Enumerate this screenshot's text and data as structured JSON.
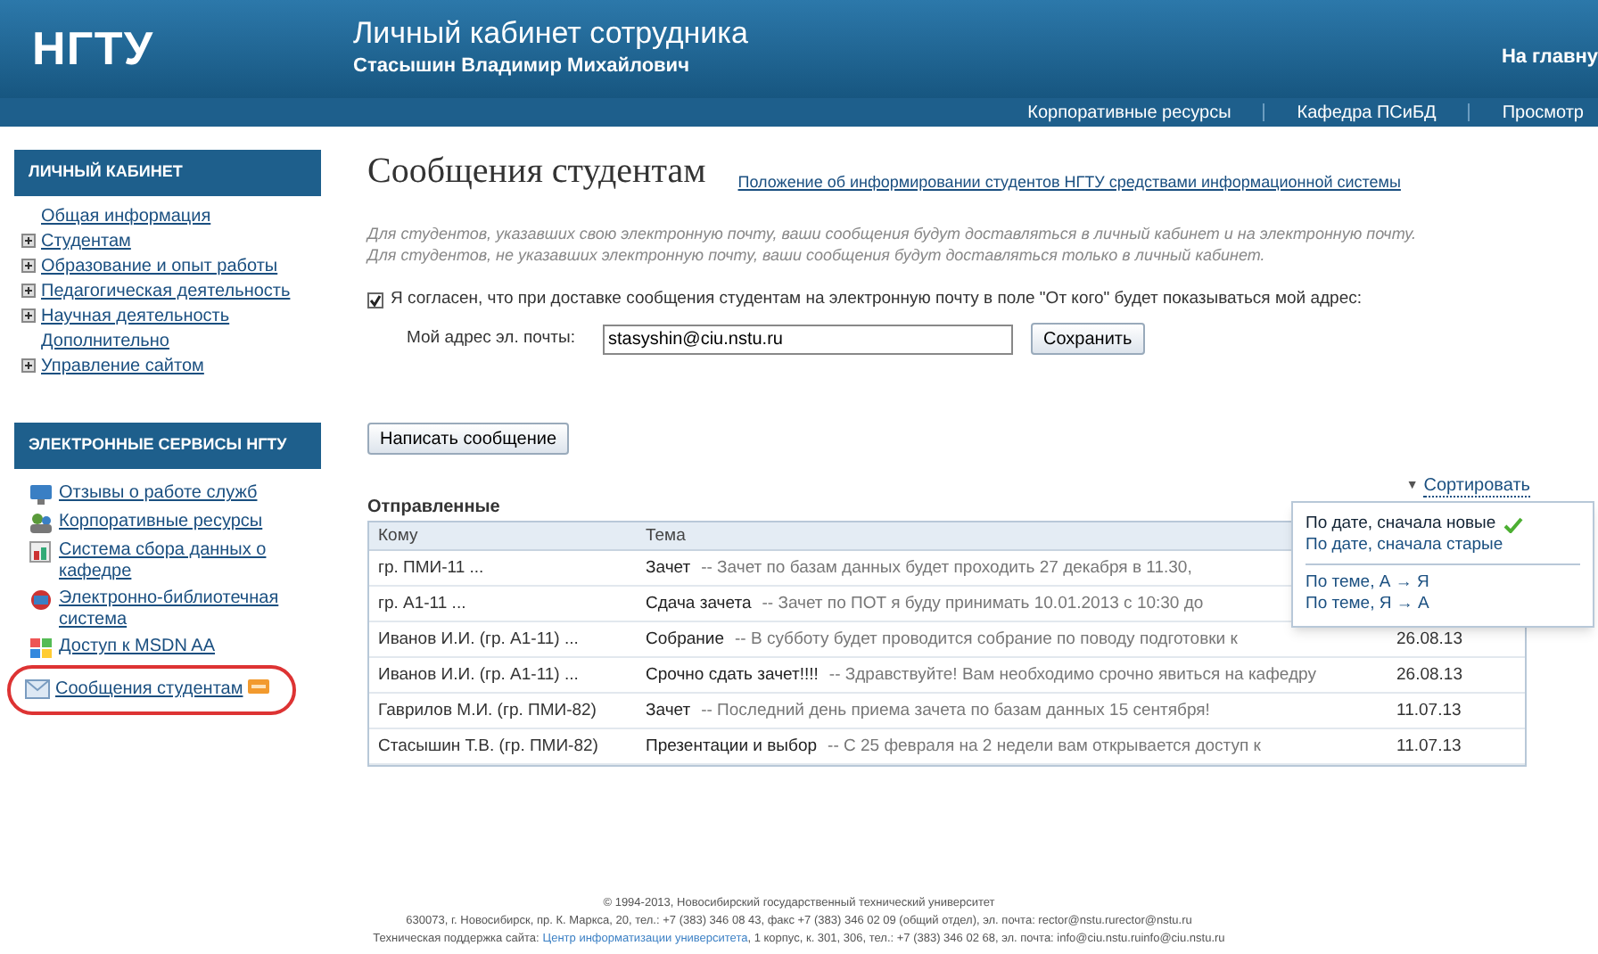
{
  "header": {
    "logo": "НГТУ",
    "title": "Личный кабинет сотрудника",
    "user": "Стасышин Владимир Михайлович",
    "home_link": "На главну"
  },
  "nav": [
    "Корпоративные ресурсы",
    "Кафедра ПСиБД",
    "Просмотр"
  ],
  "sidebar": {
    "cabinet": {
      "title": "ЛИЧНЫЙ КАБИНЕТ",
      "items": [
        {
          "label": "Общая информация",
          "kind": "leaf"
        },
        {
          "label": "Студентам",
          "kind": "node",
          "expanded": false
        },
        {
          "label": "Образование и опыт работы",
          "kind": "node",
          "expanded": false
        },
        {
          "label": "Педагогическая деятельность",
          "kind": "node",
          "expanded": false
        },
        {
          "label": "Научная деятельность",
          "kind": "node",
          "expanded": false
        },
        {
          "label": "Дополнительно",
          "kind": "leaf"
        },
        {
          "label": "Управление сайтом",
          "kind": "node",
          "expanded": false
        }
      ]
    },
    "services": {
      "title": "ЭЛЕКТРОННЫЕ СЕРВИСЫ НГТУ",
      "items": [
        {
          "label": "Отзывы о работе служб",
          "highlighted": false,
          "new": false
        },
        {
          "label": "Корпоративные ресурсы",
          "highlighted": false,
          "new": false
        },
        {
          "label": "Система сбора данных о кафедре",
          "highlighted": false,
          "new": false
        },
        {
          "label": "Электронно-библиотечная система",
          "highlighted": false,
          "new": false
        },
        {
          "label": "Доступ к MSDN AA",
          "highlighted": false,
          "new": false
        },
        {
          "label": "Сообщения студентам",
          "highlighted": true,
          "new": true
        }
      ]
    }
  },
  "main": {
    "title": "Сообщения студентам",
    "policy_link": "Положение об информировании студентов НГТУ средствами информационной системы",
    "notes": [
      "Для студентов, указавших свою электронную почту, ваши сообщения будут доставляться в личный кабинет и на электронную почту.",
      "Для студентов, не указавших электронную почту, ваши сообщения будут доставляться только в личный кабинет."
    ],
    "consent": {
      "label": "Я согласен, что при доставке сообщения студентам на электронную почту в поле \"От кого\" будет показываться мой адрес:",
      "checked": true
    },
    "email": {
      "label": "Мой адрес эл. почты:",
      "value": "stasyshin@ciu.nstu.ru"
    },
    "save_button": "Сохранить",
    "write_button": "Написать сообщение",
    "sort": {
      "caret": "▼",
      "label": "Сортировать",
      "groups": [
        [
          {
            "label": "По дате, сначала новые",
            "selected": true
          },
          {
            "label": "По дате, сначала старые",
            "selected": false
          }
        ],
        [
          {
            "label": "По теме, А → Я",
            "selected": false
          },
          {
            "label": "По теме, Я → А",
            "selected": false
          }
        ]
      ]
    },
    "table": {
      "title": "Отправленные",
      "columns": [
        "Кому",
        "Тема"
      ],
      "rows": [
        {
          "to": "гр. ПМИ-11 ...",
          "subject": "Зачет",
          "preview": "-- Зачет по базам данных будет проходить 27 декабря в 11.30,"
        },
        {
          "to": "гр. А1-11 ...",
          "subject": "Сдача зачета",
          "preview": "-- Зачет по ПОТ я буду принимать 10.01.2013 с 10:30 до"
        },
        {
          "to": "Иванов И.И. (гр. А1-11) ...",
          "subject": "Собрание",
          "preview": "-- В субботу будет проводится собрание по поводу подготовки к",
          "date": "26.08.13"
        },
        {
          "to": "Иванов И.И. (гр. А1-11) ...",
          "subject": "Срочно сдать зачет!!!!",
          "preview": "-- Здравствуйте! Вам необходимо срочно явиться на кафедру",
          "date": "26.08.13"
        },
        {
          "to": "Гаврилов М.И. (гр. ПМИ-82)",
          "subject": "Зачет",
          "preview": "-- Последний день приема зачета по базам данных 15 сентября!",
          "date": "11.07.13"
        },
        {
          "to": "Стасышин Т.В. (гр. ПМИ-82)",
          "subject": "Презентации и выбор",
          "preview": "-- С 25 февраля на 2 недели вам открывается доступ к",
          "date": "11.07.13"
        }
      ]
    }
  },
  "footer": {
    "copyright": "© 1994-2013, Новосибирский государственный технический университет",
    "address": "630073, г. Новосибирск, пр. К. Маркса, 20, тел.: +7 (383) 346 08 43, факс +7 (383) 346 02 09 (общий отдел), эл. почта: rector@nstu.rurector@nstu.ru",
    "support_label": "Техническая поддержка сайта:",
    "support_link": "Центр информатизации университета",
    "support_rest": ", 1 корпус, к. 301, 306, тел.: +7 (383) 346 02 68, эл. почта: info@ciu.nstu.ruinfo@ciu.nstu.ru"
  }
}
